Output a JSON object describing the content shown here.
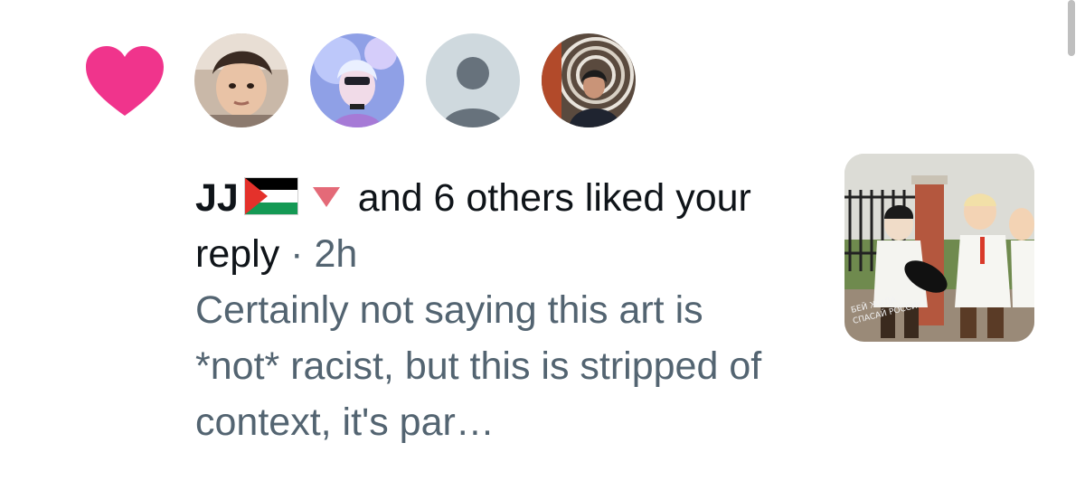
{
  "notification": {
    "type_icon": "heart-icon",
    "accent_color": "#f0348c",
    "avatars": [
      {
        "icon": "avatar-child-photo"
      },
      {
        "icon": "avatar-anime-character"
      },
      {
        "icon": "avatar-default-person"
      },
      {
        "icon": "avatar-person-photo"
      }
    ],
    "username": "JJ",
    "flag_icon": "palestine-flag-emoji",
    "marker_icon": "red-down-triangle-emoji",
    "action_text": "and 6 others liked your reply",
    "separator": "·",
    "time_ago": "2h",
    "reply_text": "Certainly not saying this art is *not* racist, but this is stripped of context, it's par…",
    "media_thumbnail": "painting-thumbnail"
  }
}
